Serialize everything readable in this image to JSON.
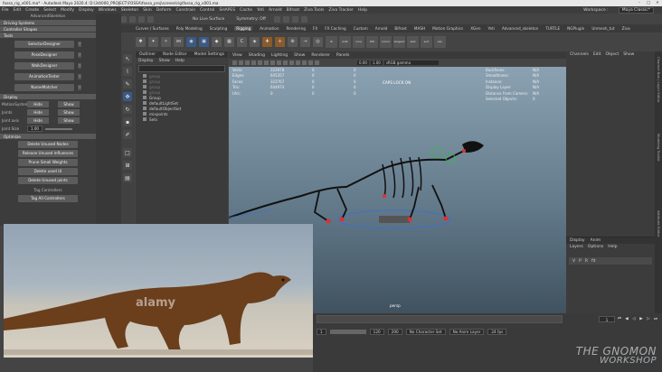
{
  "window": {
    "title": "fossa_rig_v001.ma* - Autodesk Maya 2020.4: D:\\3d\\000_PROJECT\\FOSSA\\fossa_proj\\scenes\\rig\\fossa_rig_v001.ma"
  },
  "menubar": {
    "items": [
      "File",
      "Edit",
      "Create",
      "Select",
      "Modify",
      "Display",
      "Windows",
      "Skeleton",
      "Skin",
      "Deform",
      "Constrain",
      "Control",
      "SHAPES",
      "Cache",
      "Yeti",
      "Arnold",
      "Bifrost",
      "Ziva Tools",
      "Ziva Tracker",
      "Help"
    ],
    "workspace_label": "Workspace :",
    "workspace_value": "Maya Classic*"
  },
  "statusline": {
    "mode": "Rigging",
    "surface": "No Live Surface",
    "symmetry": "Symmetry: Off"
  },
  "shelf": {
    "tabs": [
      "Curves / Surfaces",
      "Poly Modeling",
      "Sculpting",
      "Rigging",
      "Animation",
      "Rendering",
      "FX",
      "FX Caching",
      "Custom",
      "Arnold",
      "Bifrost",
      "MASH",
      "Motion Graphics",
      "XGen",
      "Yeti",
      "Advanced_skeleton",
      "TURTLE",
      "NGPlugin",
      "Unmesh_tut",
      "Ziva"
    ],
    "active": "Rigging",
    "captions": [
      "IK",
      "ik/fk",
      "cons",
      "HIK",
      "mirror",
      "tangent",
      "skel",
      "surf",
      "ALL"
    ]
  },
  "leftpanel": {
    "title": "AdvancedSkeleton",
    "sections1": [
      "Driving Systems",
      "Controller Shapes"
    ],
    "tools_header": "Tools",
    "tool_buttons": [
      "SelectorDesigner",
      "PoseDesigner",
      "WalkDesigner",
      "AnimationTester",
      "NameMatcher"
    ],
    "display_header": "Display",
    "display_rows": [
      {
        "label": "MotionSystem",
        "a": "Hide",
        "b": "Show"
      },
      {
        "label": "Joints",
        "a": "Hide",
        "b": "Show"
      },
      {
        "label": "Joint axis",
        "a": "Hide",
        "b": "Show"
      }
    ],
    "joint_size_label": "Joint Size",
    "joint_size_value": "1.00",
    "optimize_header": "Optimize",
    "optimize_buttons": [
      "Delete Unused Nodes",
      "Release Unused Influences",
      "Prune Small Weights",
      "Delete used UI",
      "Delete Unused joints"
    ],
    "tag_title": "Tag Controllers",
    "tag_button": "Tag All Controllers"
  },
  "outliner": {
    "tabs": [
      "Outliner",
      "Node Editor",
      "Model Settings"
    ],
    "menu": [
      "Display",
      "Show",
      "Help"
    ],
    "items": [
      {
        "label": "group",
        "faded": true
      },
      {
        "label": "group",
        "faded": true
      },
      {
        "label": "group",
        "faded": true
      },
      {
        "label": "group",
        "faded": true
      },
      {
        "label": "Group",
        "faded": false
      },
      {
        "label": "defaultLightSet",
        "faded": false
      },
      {
        "label": "defaultObjectSet",
        "faded": false
      },
      {
        "label": "mixpoints",
        "faded": false
      },
      {
        "label": "Sets",
        "faded": false
      }
    ]
  },
  "viewport": {
    "menu": [
      "View",
      "Shading",
      "Lighting",
      "Show",
      "Renderer",
      "Panels"
    ],
    "field1": "0.00",
    "field2": "1.00",
    "colorspace": "sRGB gamma",
    "hud_left": [
      {
        "k": "Verts:",
        "v1": "322978",
        "v2": "0",
        "v3": "0"
      },
      {
        "k": "Edges:",
        "v1": "645357",
        "v2": "0",
        "v3": "0"
      },
      {
        "k": "Faces:",
        "v1": "322767",
        "v2": "0",
        "v3": "0"
      },
      {
        "k": "Tris:",
        "v1": "644974",
        "v2": "0",
        "v3": "0"
      },
      {
        "k": "UVs:",
        "v1": "0",
        "v2": "0",
        "v3": "0"
      }
    ],
    "hud_right": [
      {
        "k": "Backfaces:",
        "v": "N/A"
      },
      {
        "k": "Smoothness:",
        "v": "N/A"
      },
      {
        "k": "Instance:",
        "v": "N/A"
      },
      {
        "k": "Display Layer:",
        "v": "N/A"
      },
      {
        "k": "Distance From Camera:",
        "v": "N/A"
      },
      {
        "k": "Selected Objects:",
        "v": "0"
      }
    ],
    "cam_lock": "CAPS LOCK ON",
    "camera": "persp"
  },
  "channelbox": {
    "menu": [
      "Channels",
      "Edit",
      "Object",
      "Show"
    ]
  },
  "layers": {
    "tabs": [
      "Display",
      "Anim"
    ],
    "menu": [
      "Layers",
      "Options",
      "Help"
    ],
    "row": {
      "v": "V",
      "p": "P",
      "r": "R",
      "name": "fit"
    }
  },
  "sidetabs": [
    "Channel Box / Layer Editor",
    "Modeling Toolkit",
    "Attribute Editor"
  ],
  "timeline": {
    "current_frame": "1"
  },
  "range": {
    "start": "1",
    "end": "120",
    "max": "200",
    "charset": "No Character Set",
    "animlayer": "No Anim Layer",
    "fps": "24 fps"
  },
  "overlay": {
    "stock_mark": "alamy"
  },
  "watermark": {
    "line1": "THE GNOMON",
    "line2": "WORKSHOP"
  }
}
